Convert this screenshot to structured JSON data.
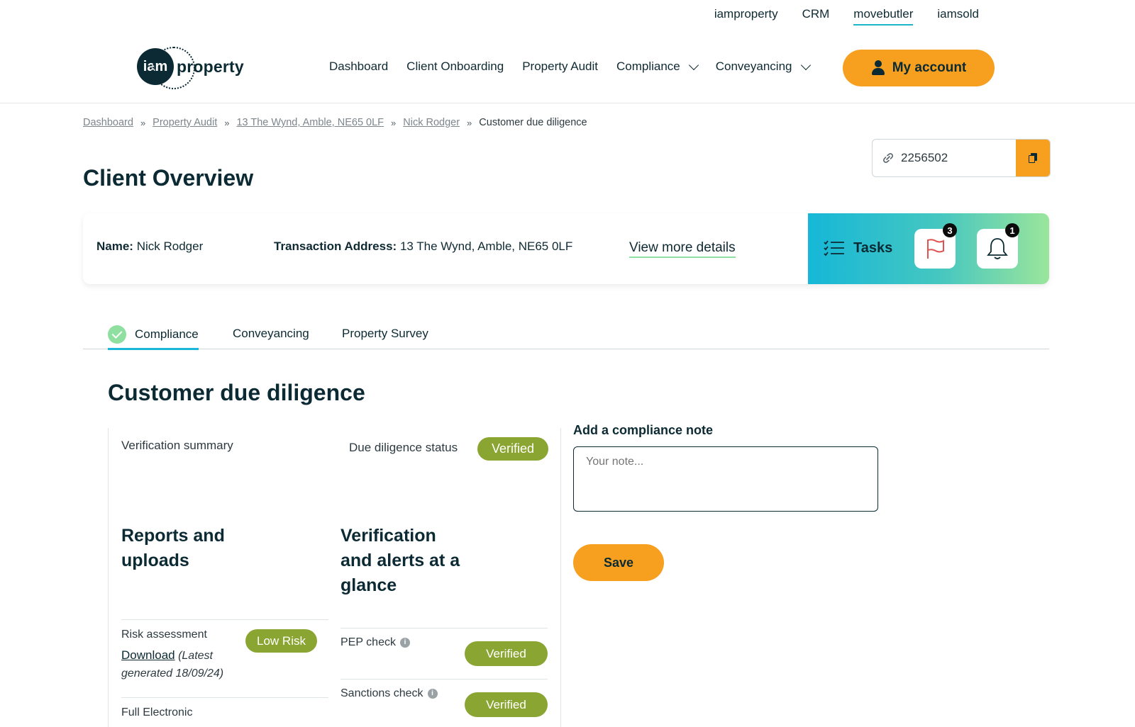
{
  "top_links": {
    "iamproperty": "iamproperty",
    "crm": "CRM",
    "movebutler": "movebutler",
    "iamsold": "iamsold"
  },
  "logo": {
    "circle_text": "iam",
    "text": "property"
  },
  "nav": {
    "dashboard": "Dashboard",
    "client_onboarding": "Client Onboarding",
    "property_audit": "Property Audit",
    "compliance": "Compliance",
    "conveyancing": "Conveyancing",
    "my_account": "My account"
  },
  "breadcrumb": {
    "dashboard": "Dashboard",
    "property_audit": "Property Audit",
    "address": "13 The Wynd, Amble, NE65 0LF",
    "client": "Nick Rodger",
    "current": "Customer due diligence",
    "separator": "»"
  },
  "reference": {
    "id": "2256502"
  },
  "page_title": "Client Overview",
  "client_card": {
    "name_label": "Name:",
    "name_value": "Nick Rodger",
    "address_label": "Transaction Address:",
    "address_value": "13 The Wynd, Amble, NE65 0LF",
    "view_more": "View more details",
    "tasks_label": "Tasks",
    "flag_count": "3",
    "notification_count": "1"
  },
  "tabs": {
    "compliance": "Compliance",
    "conveyancing": "Conveyancing",
    "property_survey": "Property Survey"
  },
  "section_title": "Customer due diligence",
  "summary": {
    "verification_summary": "Verification summary",
    "due_diligence_status_label": "Due diligence status",
    "due_diligence_status": "Verified",
    "reports_heading_line1": "Reports and",
    "reports_heading_line2": "uploads",
    "verification_heading_line1": "Verification",
    "verification_heading_line2": "and alerts at a",
    "verification_heading_line3": "glance"
  },
  "reports": {
    "risk_assessment_label": "Risk assessment",
    "risk_level": "Low Risk",
    "download_link": "Download",
    "latest_line1": "(Latest",
    "latest_line2": "generated 18/09/24)",
    "full_electronic": "Full Electronic"
  },
  "checks": {
    "pep_label": "PEP check",
    "pep_status": "Verified",
    "sanctions_label": "Sanctions check",
    "sanctions_status": "Verified",
    "info_glyph": "i"
  },
  "compliance_note": {
    "label": "Add a compliance note",
    "placeholder": "Your note...",
    "save": "Save"
  },
  "colors": {
    "accent_orange": "#f7a01f",
    "verified_green": "#8aa531",
    "brand_dark": "#0b2a33",
    "tab_active": "#1bb7d8"
  }
}
